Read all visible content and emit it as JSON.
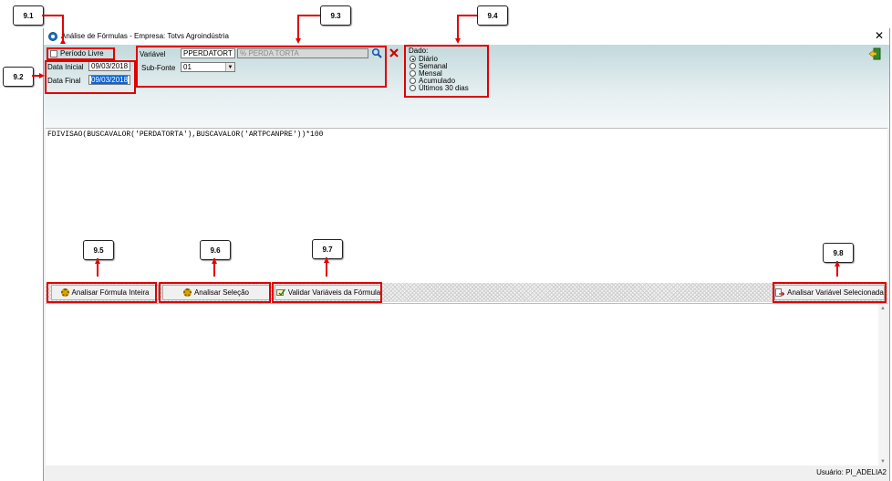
{
  "window": {
    "title": "Análise de Fórmulas  -  Empresa: Totvs Agroindústria",
    "close_glyph": "✕"
  },
  "filters": {
    "periodo_livre_label": "Período Livre",
    "periodo_livre_checked": false,
    "data_inicial_label": "Data Inicial",
    "data_inicial_value": "09/03/2018",
    "data_final_label": "Data Final",
    "data_final_value": "09/03/2018"
  },
  "variavel": {
    "label": "Variável",
    "code": "PPERDATORT",
    "description": "% PERDA TORTA",
    "subfonte_label": "Sub-Fonte",
    "subfonte_value": "01"
  },
  "dado": {
    "label": "Dado:",
    "options": [
      "Diário",
      "Semanal",
      "Mensal",
      "Acumulado",
      "Últimos 30 dias"
    ],
    "selected": "Diário"
  },
  "editor": {
    "formula": "FDIVISAO(BUSCAVALOR('PERDATORTA'),BUSCAVALOR('ARTPCANPRE'))*100"
  },
  "buttons": {
    "analisar_formula": "Analisar Fórmula Inteira",
    "analisar_selecao": "Analisar Seleção",
    "validar_variaveis": "Validar Variáveis da Fórmula",
    "analisar_variavel": "Analisar Variável Selecionada"
  },
  "status": {
    "user": "Usuário: PI_ADELIA2"
  },
  "callouts": [
    "9.1",
    "9.2",
    "9.3",
    "9.4",
    "9.5",
    "9.6",
    "9.7",
    "9.8"
  ],
  "colors": {
    "annotation_red": "#e00000",
    "selection_blue": "#0a64d8",
    "toolbar_teal": "#c2d9dc"
  }
}
